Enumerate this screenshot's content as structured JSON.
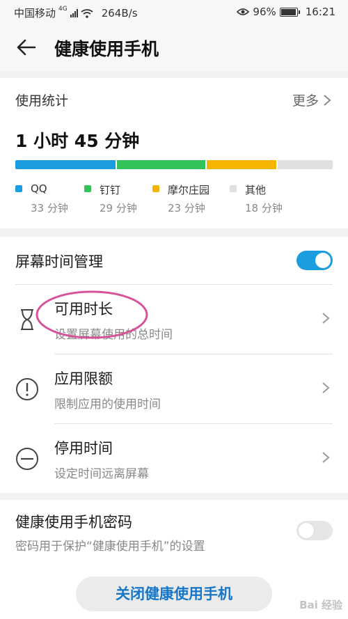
{
  "status_bar": {
    "carrier": "中国移动",
    "network": "4G",
    "speed": "264B/s",
    "battery": "96%",
    "time": "16:21"
  },
  "header": {
    "title": "健康使用手机"
  },
  "usage": {
    "heading": "使用统计",
    "more_label": "更多",
    "total": "1 小时 45 分钟",
    "apps": [
      {
        "name": "QQ",
        "time": "33 分钟",
        "color": "#1a9ee0",
        "minutes": 33
      },
      {
        "name": "钉钉",
        "time": "29 分钟",
        "color": "#33c25a",
        "minutes": 29
      },
      {
        "name": "摩尔庄园",
        "time": "23 分钟",
        "color": "#f5b400",
        "minutes": 23
      },
      {
        "name": "其他",
        "time": "18 分钟",
        "color": "#e0e0e0",
        "minutes": 18
      }
    ]
  },
  "screen_time": {
    "label": "屏幕时间管理",
    "enabled": true,
    "items": [
      {
        "title": "可用时长",
        "subtitle": "设置屏幕使用的总时间",
        "icon": "hourglass-icon"
      },
      {
        "title": "应用限额",
        "subtitle": "限制应用的使用时间",
        "icon": "exclamation-circle-icon"
      },
      {
        "title": "停用时间",
        "subtitle": "设定时间远离屏幕",
        "icon": "minus-circle-icon"
      }
    ]
  },
  "password": {
    "title": "健康使用手机密码",
    "subtitle": "密码用于保护“健康使用手机”的设置",
    "enabled": false
  },
  "close_button": "关闭健康使用手机",
  "watermark": "Bai 经验",
  "accent_color": "#1a9ee0",
  "highlight_color": "#d6539a"
}
